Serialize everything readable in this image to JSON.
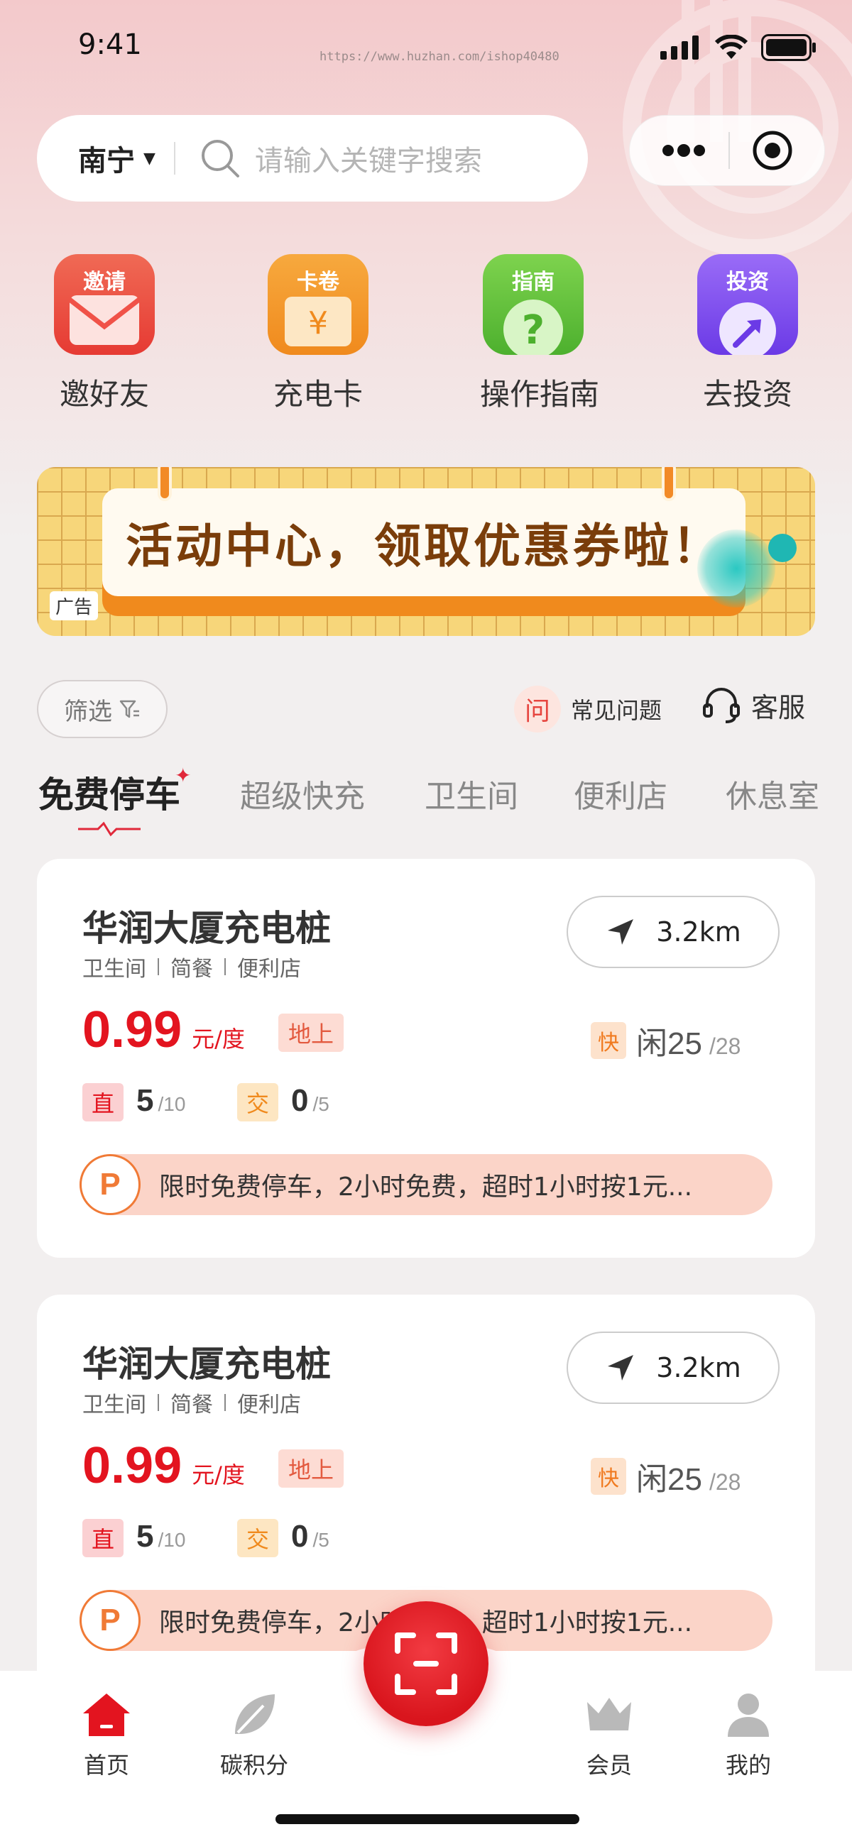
{
  "status_bar": {
    "time": "9:41",
    "url_watermark": "https://www.huzhan.com/ishop40480"
  },
  "search": {
    "city": "南宁",
    "placeholder": "请输入关键字搜索"
  },
  "quick_actions": [
    {
      "tag": "邀请",
      "label": "邀好友",
      "icon": "envelope-icon",
      "color": "#e9463f"
    },
    {
      "tag": "卡卷",
      "label": "充电卡",
      "icon": "coupon-icon",
      "color": "#f2952a"
    },
    {
      "tag": "指南",
      "label": "操作指南",
      "icon": "question-icon",
      "color": "#5cc23a"
    },
    {
      "tag": "投资",
      "label": "去投资",
      "icon": "invest-icon",
      "color": "#7b4cf0"
    }
  ],
  "banner": {
    "title": "活动中心，领取优惠券啦！",
    "ad_label": "广告"
  },
  "filter": {
    "label": "筛选"
  },
  "help": {
    "faq_icon_char": "问",
    "faq_label": "常见问题",
    "service_label": "客服"
  },
  "tabs": [
    "免费停车",
    "超级快充",
    "卫生间",
    "便利店",
    "休息室"
  ],
  "stations": [
    {
      "name": "华润大厦充电桩",
      "amenities": [
        "卫生间",
        "简餐",
        "便利店"
      ],
      "distance": "3.2km",
      "price": "0.99",
      "price_unit": "元/度",
      "location_tag": "地上",
      "fast_badge": "快",
      "idle": "闲25",
      "idle_total": "/28",
      "dc_badge": "直",
      "dc_available": "5",
      "dc_total": "/10",
      "ac_badge": "交",
      "ac_available": "0",
      "ac_total": "/5",
      "parking_icon": "P",
      "parking_note": "限时免费停车，2小时免费，超时1小时按1元..."
    },
    {
      "name": "华润大厦充电桩",
      "amenities": [
        "卫生间",
        "简餐",
        "便利店"
      ],
      "distance": "3.2km",
      "price": "0.99",
      "price_unit": "元/度",
      "location_tag": "地上",
      "fast_badge": "快",
      "idle": "闲25",
      "idle_total": "/28",
      "dc_badge": "直",
      "dc_available": "5",
      "dc_total": "/10",
      "ac_badge": "交",
      "ac_available": "0",
      "ac_total": "/5",
      "parking_icon": "P",
      "parking_note": "限时免费停车，2小时免费，超时1小时按1元..."
    }
  ],
  "bottom_nav": [
    {
      "label": "首页",
      "icon": "home-icon",
      "active": true
    },
    {
      "label": "碳积分",
      "icon": "leaf-icon",
      "active": false
    },
    {
      "label": "会员",
      "icon": "crown-icon",
      "active": false
    },
    {
      "label": "我的",
      "icon": "user-icon",
      "active": false
    }
  ],
  "colors": {
    "brand_red": "#e3141f",
    "orange": "#f07a36",
    "banner_yellow": "#f7d67a"
  }
}
